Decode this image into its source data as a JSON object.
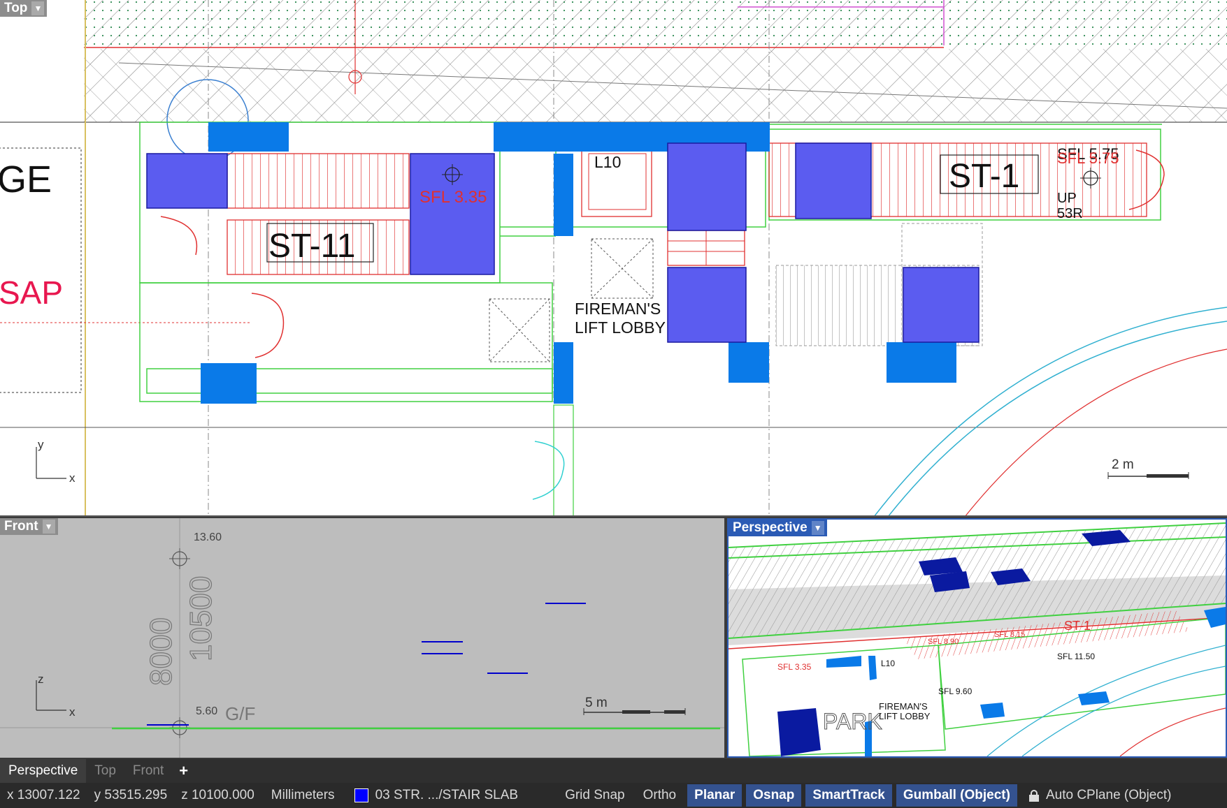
{
  "viewports": {
    "top": {
      "label": "Top",
      "labels": {
        "ge": "GE",
        "sap": "SAP",
        "st11": "ST-11",
        "sfl335": "SFL 3.35",
        "l10": "L10",
        "st1": "ST-1",
        "sfl575a": "SFL 5.75",
        "sfl575b": "SFL 5.75",
        "up": "UP",
        "r53": "53R",
        "fireman1": "FIREMAN'S",
        "fireman2": "LIFT LOBBY",
        "axis_y": "y",
        "axis_x": "x",
        "scale": "2 m"
      }
    },
    "front": {
      "label": "Front",
      "labels": {
        "v1360": "13.60",
        "v10500": "10500",
        "v8000": "8000",
        "v560": "5.60",
        "gf": "G/F",
        "axis_z": "z",
        "axis_x": "x",
        "scale": "5 m"
      }
    },
    "perspective": {
      "label": "Perspective",
      "labels": {
        "l10": "L10",
        "st1": "ST-1",
        "sfl335": "SFL 3.35",
        "sfl960": "SFL 9.60",
        "sfl1150": "SFL 11.50",
        "sfl890": "SFL 8.90",
        "sfl815": "SFL 8.15",
        "park": "PARK",
        "fireman1": "FIREMAN'S",
        "fireman2": "LIFT LOBBY"
      }
    }
  },
  "tabs": [
    {
      "label": "Perspective",
      "active": true
    },
    {
      "label": "Top",
      "active": false
    },
    {
      "label": "Front",
      "active": false
    }
  ],
  "tab_add_label": "+",
  "status": {
    "x": "x 13007.122",
    "y": "y 53515.295",
    "z": "z 10100.000",
    "units": "Millimeters",
    "layer": "03 STR. .../STAIR SLAB",
    "layer_color": "#0000ff",
    "toggles": [
      {
        "label": "Grid Snap",
        "on": false
      },
      {
        "label": "Ortho",
        "on": false
      },
      {
        "label": "Planar",
        "on": true
      },
      {
        "label": "Osnap",
        "on": true
      },
      {
        "label": "SmartTrack",
        "on": true
      },
      {
        "label": "Gumball (Object)",
        "on": true
      }
    ],
    "cplane": "Auto CPlane (Object)"
  }
}
